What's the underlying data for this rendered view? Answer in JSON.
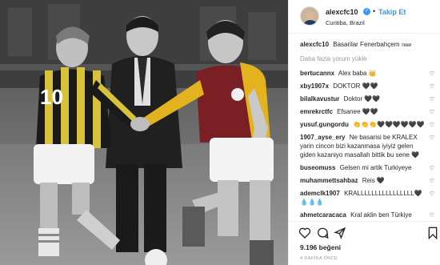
{
  "post": {
    "username": "alexcfc10",
    "follow_label": "Takip Et",
    "location": "Curitiba, Brazil",
    "caption_text": "Basarilar Fenerbahçem",
    "caption_tag": "ᴛʀʙʀ",
    "more_comments": "Daha fazla yorum yükle",
    "likes": "9.196 beğeni",
    "timestamp": "4 DAKİKA ÖNCE"
  },
  "comments": [
    {
      "user": "bertucannx",
      "text": "Alex baba 👑"
    },
    {
      "user": "xby1907x",
      "text": "DOKTOR 🖤🖤"
    },
    {
      "user": "bilalkavustur",
      "text": "Doktor 🖤🖤"
    },
    {
      "user": "emrekrctfc",
      "text": "Efsanee 🖤🖤"
    },
    {
      "user": "yusuf.gungordu",
      "text": "👏👏👏🖤🖤🖤🖤🖤🖤"
    },
    {
      "user": "1907_ayse_ery",
      "text": "Ne basarisi be KRALEX yarin cincon bizi kazanmasa iyiyiz gelen giden kazaniyo masallah bittik bu sene 🖤"
    },
    {
      "user": "buseomuss",
      "text": "Gelsen mi artik Turkiyeye"
    },
    {
      "user": "muhammettsahbaz",
      "text": "Reis 🖤"
    },
    {
      "user": "ademclk1907",
      "text": "KRALLLLLLLLLLLLLLLL🖤💧💧💧"
    },
    {
      "user": "ahmetcaracaca",
      "text": "Kral aklin ben Türkiye"
    }
  ],
  "photo": {
    "jersey_number": "10"
  },
  "icons": [
    "heart-icon",
    "comment-icon",
    "share-icon",
    "bookmark-icon",
    "verified-icon"
  ]
}
